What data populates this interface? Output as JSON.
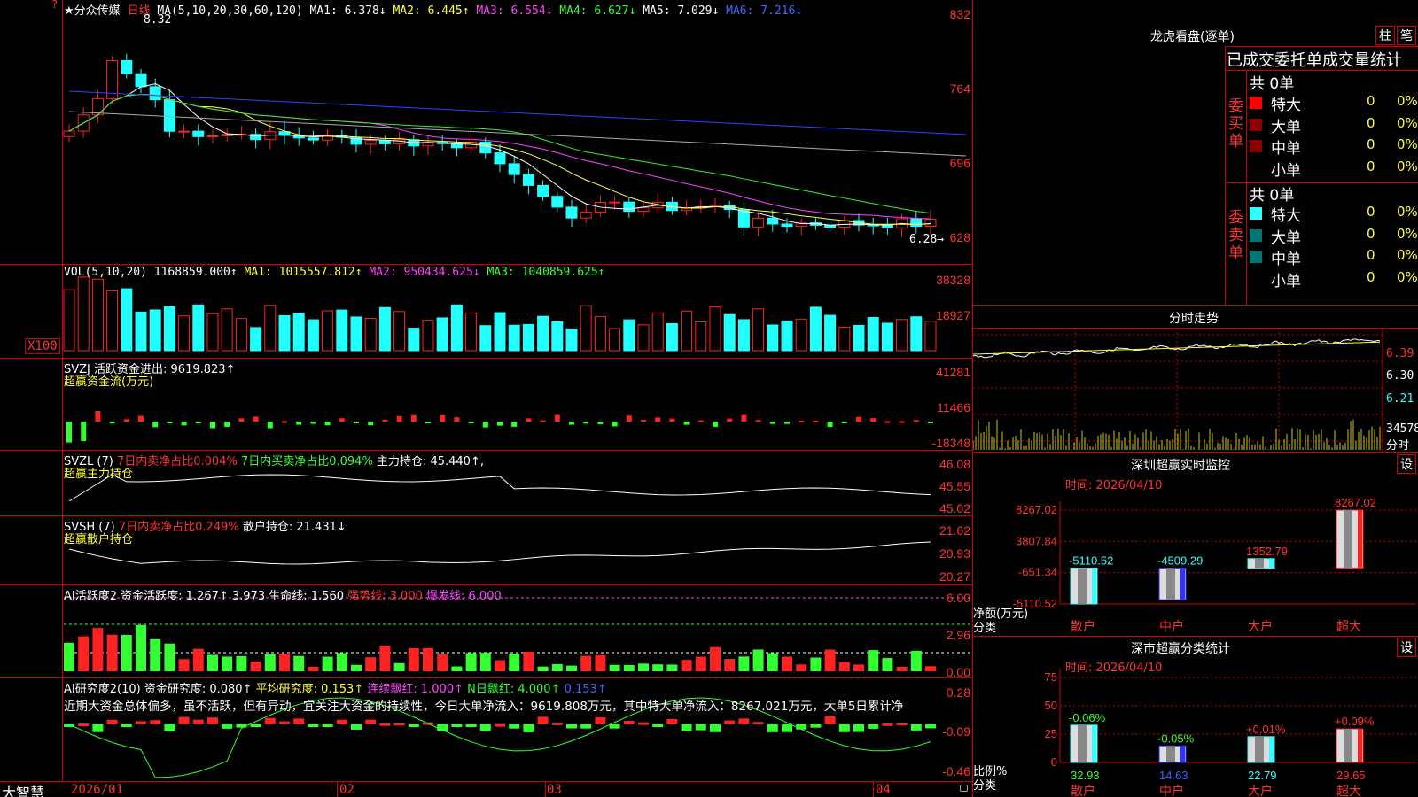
{
  "colors": {
    "up": "#ff2222",
    "down": "#22ffff",
    "bg": "#000000",
    "grid": "#cc0000",
    "ma1": "#ffffff",
    "ma2": "#ffff44",
    "ma3": "#ff44ff",
    "ma4": "#33ee33",
    "ma5": "#aaaaaa",
    "ma6": "#3344ff"
  },
  "main": {
    "title": "★分众传媒",
    "period": "日线",
    "ma_label": "MA(5,10,20,30,60,120)",
    "ma1": "MA1: 6.378↓",
    "ma2": "MA2: 6.445↑",
    "ma3": "MA3: 6.554↓",
    "ma4": "MA4: 6.627↓",
    "ma5": "MA5: 7.029↓",
    "ma6": "MA6: 7.216↓",
    "high_mark": "8.32",
    "low_mark": "6.28→",
    "y_labels": [
      "832",
      "764",
      "696",
      "628"
    ]
  },
  "vol": {
    "hdr": "VOL(5,10,20)",
    "val": "1168859.000↑",
    "ma1": "MA1: 1015557.812↑",
    "ma2": "MA2: 950434.625↓",
    "ma3": "MA3: 1040859.625↑",
    "y_labels": [
      "38328",
      "18927"
    ],
    "unit": "X100"
  },
  "svzj": {
    "hdr": "SVZJ  活跃资金进出: 9619.823↑",
    "sub": "超赢资金流(万元)",
    "y_labels": [
      "41281",
      "11466",
      "-18348"
    ]
  },
  "svzl": {
    "hdr": "SVZL (7)",
    "t1": "7日内卖净占比0.004%",
    "t2": "7日内买卖净占比0.094%",
    "t3": "主力持仓: 45.440↑,",
    "sub": "超赢主力持仓",
    "y_labels": [
      "46.08",
      "45.55",
      "45.02"
    ]
  },
  "svsh": {
    "hdr": "SVSH (7)",
    "t1": "7日内卖净占比0.249%",
    "t2": "散户持仓: 21.431↓",
    "sub": "超赢散户持仓",
    "y_labels": [
      "21.62",
      "20.93",
      "20.27"
    ]
  },
  "ai1": {
    "hdr": "AI活跃度2",
    "t1": "资金活跃度: 1.267↑",
    "t2": "3.973",
    "t3": "生命线: 1.560",
    "t4": "强势线: 3.000",
    "t5": "爆发线: 6.000",
    "y_labels": [
      "6.00",
      "2.96",
      "0.00"
    ]
  },
  "ai2": {
    "hdr": "AI研究度2(10)",
    "t1": "资金研究度: 0.080↑",
    "t2": "平均研究度: 0.153↑",
    "t3": "连续飘红: 1.000↑",
    "t4": "N日飘红: 4.000↑",
    "t5": "0.153↑",
    "note": "近期大资金总体偏多，虽不活跃，但有异动，宜关注大资金的持续性，今日大单净流入：9619.808万元，其中特大单净流入：8267.021万元，大单5日累计净",
    "y_labels": [
      "0.28",
      "-0.09",
      "-0.46"
    ]
  },
  "xaxis": {
    "brand": "大智慧",
    "labels": [
      "2026/01",
      "02",
      "03",
      "04"
    ]
  },
  "lhb": {
    "title": "龙虎看盘(逐单)",
    "btn1": "柱",
    "btn2": "笔",
    "header": "已成交委托单成交量统计",
    "buy_label": "委买单",
    "sell_label": "委卖单",
    "buy_total": "共 0单",
    "sell_total": "共 0单",
    "rows_buy": [
      {
        "name": "特大",
        "n": "0",
        "p": "0%"
      },
      {
        "name": "大单",
        "n": "0",
        "p": "0%"
      },
      {
        "name": "中单",
        "n": "0",
        "p": "0%"
      },
      {
        "name": "小单",
        "n": "0",
        "p": "0%"
      }
    ],
    "rows_sell": [
      {
        "name": "特大",
        "n": "0",
        "p": "0%"
      },
      {
        "name": "大单",
        "n": "0",
        "p": "0%"
      },
      {
        "name": "中单",
        "n": "0",
        "p": "0%"
      },
      {
        "name": "小单",
        "n": "0",
        "p": "0%"
      }
    ]
  },
  "fenshi": {
    "title": "分时走势",
    "y_labels": [
      "6.39",
      "6.30",
      "6.21"
    ],
    "vol_label": "34578",
    "vol_unit": "分时"
  },
  "sz_monitor": {
    "title": "深圳超赢实时监控",
    "btn": "设",
    "time": "时间: 2026/04/10",
    "ylabel": "净额(万元)",
    "xlabel": "分类",
    "y_labels": [
      "8267.02",
      "3807.84",
      "-651.34",
      "-5110.52"
    ],
    "chart_data": {
      "type": "bar",
      "categories": [
        "散户",
        "中户",
        "大户",
        "超大"
      ],
      "values": [
        -5110.52,
        -4509.29,
        1352.79,
        8267.02
      ],
      "ylim": [
        -5110.52,
        8267.02
      ]
    }
  },
  "sz_class": {
    "title": "深市超赢分类统计",
    "btn": "设",
    "time": "时间: 2026/04/10",
    "ylabel": "比例%",
    "xlabel": "分类",
    "y_labels": [
      "75",
      "50",
      "25",
      "0"
    ],
    "chart_data": {
      "type": "bar",
      "categories": [
        "散户",
        "中户",
        "大户",
        "超大"
      ],
      "values": [
        32.93,
        14.63,
        22.79,
        29.65
      ],
      "changes": [
        "-0.06%",
        "-0.05%",
        "+0.01%",
        "+0.09%"
      ],
      "ylim": [
        0,
        75
      ]
    }
  }
}
